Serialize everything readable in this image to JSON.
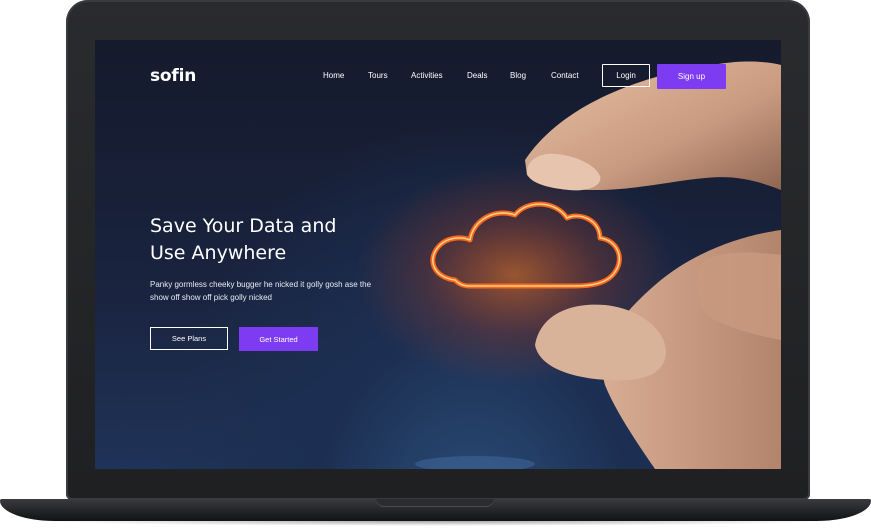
{
  "brand": {
    "logo": "sofin"
  },
  "nav": {
    "items": [
      "Home",
      "Tours",
      "Activities",
      "Deals",
      "Blog",
      "Contact"
    ]
  },
  "auth": {
    "login_label": "Login",
    "signup_label": "Sign up"
  },
  "hero": {
    "title_line1": "Save Your Data and",
    "title_line2": "Use Anywhere",
    "description": "Panky gormless cheeky bugger he nicked it golly gosh ase the show off show off pick golly nicked",
    "see_plans_label": "See Plans",
    "get_started_label": "Get Started"
  },
  "colors": {
    "accent": "#7d3cf2",
    "background": "#151a2c",
    "text": "#ffffff"
  }
}
